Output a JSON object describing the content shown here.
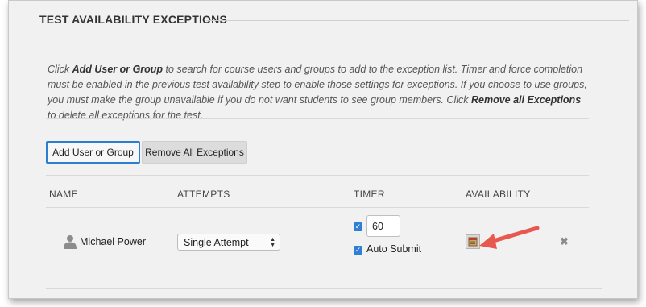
{
  "section": {
    "title": "TEST AVAILABILITY EXCEPTIONS"
  },
  "instructions": {
    "part1": "Click ",
    "bold1": "Add User or Group",
    "part2": " to search for course users and groups to add to the exception list. Timer and force completion must be enabled in the previous test availability step to enable those settings for exceptions. If you choose to use groups, you must make the group unavailable if you do not want students to see group members. Click ",
    "bold2": "Remove all Exceptions",
    "part3": " to delete all exceptions for the test."
  },
  "buttons": {
    "add_user_or_group": "Add User or Group",
    "remove_all_exceptions": "Remove All Exceptions"
  },
  "table": {
    "columns": [
      "NAME",
      "ATTEMPTS",
      "TIMER",
      "AVAILABILITY"
    ],
    "rows": [
      {
        "name": "Michael Power",
        "attempts": "Single Attempt",
        "timer_enabled": true,
        "timer_value": "60",
        "auto_submit_enabled": true,
        "auto_submit_label": "Auto Submit",
        "availability_icon": "calendar-icon",
        "remove_icon": "close-icon"
      }
    ]
  },
  "colors": {
    "accent": "#2a7fd0",
    "annotation_arrow": "#e8584e"
  }
}
